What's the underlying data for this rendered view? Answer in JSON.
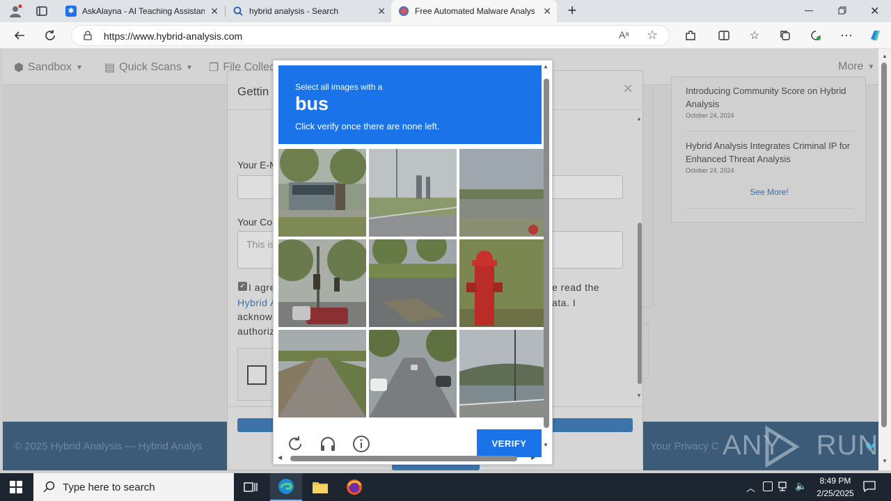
{
  "browser": {
    "tabs": [
      {
        "title": "AskAlayna - AI Teaching Assistan",
        "icon": "askalayna-favicon"
      },
      {
        "title": "hybrid analysis - Search",
        "icon": "search-favicon"
      },
      {
        "title": "Free Automated Malware Analysi",
        "icon": "hybrid-favicon",
        "active": true
      }
    ],
    "url": "https://www.hybrid-analysis.com"
  },
  "page": {
    "nav": {
      "sandbox": "Sandbox",
      "quick_scans": "Quick Scans",
      "file_collections": "File Collec",
      "more": "More"
    },
    "news": [
      {
        "title": "Introducing Community Score on Hybrid Analysis",
        "date": "October 24, 2024"
      },
      {
        "title": "Hybrid Analysis Integrates Criminal IP for Enhanced Threat Analysis",
        "date": "October 24, 2024"
      }
    ],
    "see_more": "See More!",
    "footer": {
      "copyright": "© 2025 Hybrid Analysis — Hybrid Analys",
      "privacy": "Your Privacy C"
    }
  },
  "modal": {
    "title": "Gettin",
    "email_label": "Your E-M",
    "comment_label": "Your Co",
    "comment_placeholder": "This is",
    "agree_line1_left": "I agre",
    "agree_line1_right": "e read the",
    "agree_line2_link": "Hybrid A",
    "agree_line2_right": "ata. I",
    "agree_line3": "acknow",
    "agree_line4": "authoriz",
    "close": "×"
  },
  "captcha": {
    "instruction_small": "Select all images with a",
    "target": "bus",
    "instruction_sub": "Click verify once there are none left.",
    "verify_label": "VERIFY",
    "grid": [
      "bus on street",
      "bridge over highway",
      "shoreline",
      "traffic lights intersection",
      "road with trees",
      "fire hydrant",
      "bike lane road",
      "street with parked cars",
      "waterfront railing"
    ]
  },
  "watermark": "ANY RUN",
  "taskbar": {
    "search_placeholder": "Type here to search",
    "time": "8:49 PM",
    "date": "2/25/2025"
  }
}
